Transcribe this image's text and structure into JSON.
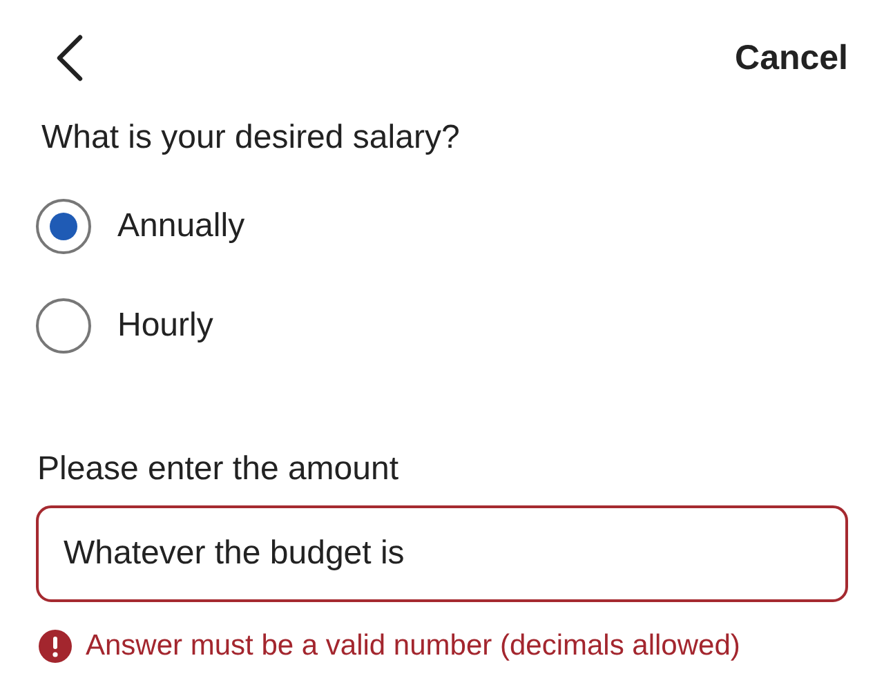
{
  "header": {
    "cancel": "Cancel"
  },
  "question": "What is your desired salary?",
  "options": [
    {
      "label": "Annually",
      "selected": true
    },
    {
      "label": "Hourly",
      "selected": false
    }
  ],
  "amount": {
    "label": "Please enter the amount",
    "value": "Whatever the budget is",
    "error": true
  },
  "error_message": "Answer must be a valid number (decimals allowed)"
}
